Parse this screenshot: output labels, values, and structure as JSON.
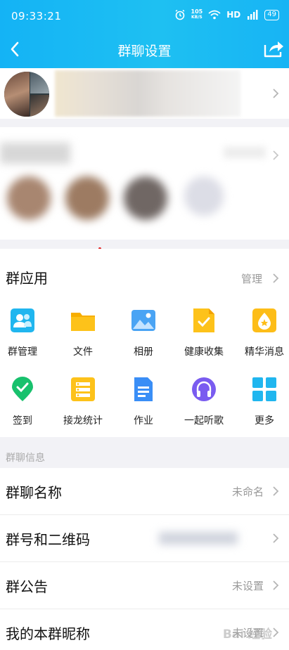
{
  "status_bar": {
    "time": "09:33:21",
    "net_speed_value": "105",
    "net_speed_unit": "KB/S",
    "hd": "HD",
    "signal": "4G",
    "battery": "49"
  },
  "header": {
    "title": "群聊设置"
  },
  "apps": {
    "title": "群应用",
    "manage_label": "管理",
    "items": [
      {
        "label": "群管理",
        "icon": "group-manage-icon"
      },
      {
        "label": "文件",
        "icon": "folder-icon"
      },
      {
        "label": "相册",
        "icon": "album-icon"
      },
      {
        "label": "健康收集",
        "icon": "health-collect-icon"
      },
      {
        "label": "精华消息",
        "icon": "essence-icon"
      },
      {
        "label": "签到",
        "icon": "checkin-icon"
      },
      {
        "label": "接龙统计",
        "icon": "chain-stats-icon"
      },
      {
        "label": "作业",
        "icon": "homework-icon"
      },
      {
        "label": "一起听歌",
        "icon": "headphones-icon"
      },
      {
        "label": "更多",
        "icon": "more-grid-icon"
      }
    ]
  },
  "info": {
    "section_label": "群聊信息",
    "rows": [
      {
        "title": "群聊名称",
        "value": "未命名"
      },
      {
        "title": "群号和二维码",
        "value": ""
      },
      {
        "title": "群公告",
        "value": "未设置"
      },
      {
        "title": "我的本群昵称",
        "value": "未设置"
      }
    ]
  },
  "watermark": "Bai 经验",
  "colors": {
    "header": "#1ab9f4",
    "folder": "#fdc21a",
    "green": "#18c16d",
    "blue": "#3a8ef6",
    "purple": "#7a5cf0",
    "arrow": "#e02020"
  }
}
